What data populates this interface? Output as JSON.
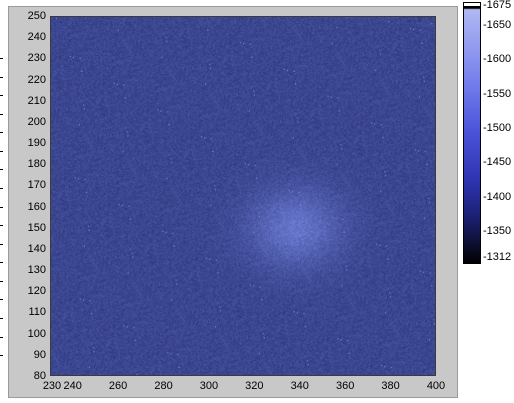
{
  "graph": {
    "y_axis": {
      "min": 80,
      "max": 250,
      "tick_labels": [
        "250",
        "240",
        "230",
        "220",
        "210",
        "200",
        "190",
        "180",
        "170",
        "160",
        "150",
        "140",
        "130",
        "120",
        "110",
        "100",
        "90",
        "80"
      ]
    },
    "x_axis": {
      "min": 230,
      "max": 400,
      "tick_labels": [
        "230",
        "240",
        "260",
        "280",
        "300",
        "320",
        "340",
        "360",
        "380",
        "400"
      ]
    },
    "colors": {
      "background_field": "#243090",
      "blob": "#4e5ce0",
      "panel": "#c8c8c8"
    },
    "colorbar": {
      "labels": [
        "1675",
        "1650",
        "1600",
        "1550",
        "1500",
        "1450",
        "1400",
        "1350",
        "1312"
      ],
      "min": 1312,
      "max": 1675
    }
  },
  "chart_data": {
    "type": "heatmap",
    "x_range": [
      230,
      400
    ],
    "y_range": [
      80,
      250
    ],
    "z_range": [
      1312,
      1675
    ],
    "xlabel": "",
    "ylabel": "",
    "x_ticks": [
      230,
      240,
      260,
      280,
      300,
      320,
      340,
      360,
      380,
      400
    ],
    "y_ticks": [
      80,
      90,
      100,
      110,
      120,
      130,
      140,
      150,
      160,
      170,
      180,
      190,
      200,
      210,
      220,
      230,
      240,
      250
    ],
    "colorbar_ticks": [
      1312,
      1350,
      1400,
      1450,
      1500,
      1550,
      1600,
      1650,
      1675
    ],
    "features": [
      {
        "label": "",
        "x": 338,
        "y": 150,
        "peak_value": 1520
      }
    ],
    "background_value": 1420
  }
}
